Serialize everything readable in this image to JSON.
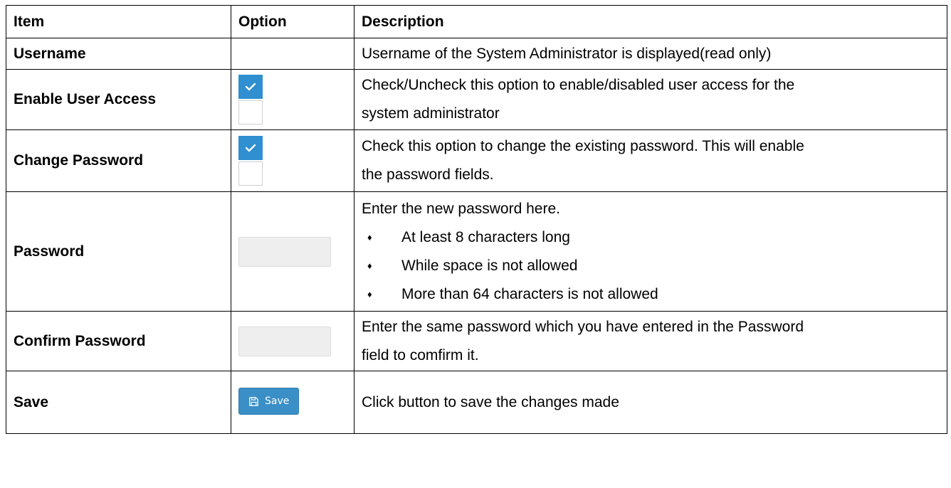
{
  "table": {
    "headers": {
      "item": "Item",
      "option": "Option",
      "description": "Description"
    },
    "rows": {
      "username": {
        "item": "Username",
        "description": "Username of the System Administrator is displayed(read only)"
      },
      "enable_user_access": {
        "item": "Enable User Access",
        "checkbox_checked_state": "checked",
        "checkbox_unchecked_state": "unchecked",
        "description_line1": "Check/Uncheck this option to enable/disabled user access for the",
        "description_line2": "system administrator"
      },
      "change_password": {
        "item": "Change Password",
        "checkbox_checked_state": "checked",
        "checkbox_unchecked_state": "unchecked",
        "description_line1": "Check this option to change the existing password. This will enable",
        "description_line2": "the password fields."
      },
      "password": {
        "item": "Password",
        "input_value": "",
        "description_intro": "Enter the new password here.",
        "bullets": [
          "At least 8 characters long",
          "While space is not allowed",
          "More than 64 characters is not allowed"
        ],
        "bullet_glyph": "♦"
      },
      "confirm_password": {
        "item": "Confirm Password",
        "input_value": "",
        "description_line1": "Enter the same password which you have entered in the Password",
        "description_line2": "field to comfirm it."
      },
      "save": {
        "item": "Save",
        "button_label": "Save",
        "button_icon": "floppy-disk-icon",
        "description": "Click button to save the changes made"
      }
    }
  },
  "colors": {
    "checkbox_checked": "#2f8fd0",
    "button_background": "#3a8fc7",
    "input_background": "#eeeeee",
    "border": "#000000"
  }
}
